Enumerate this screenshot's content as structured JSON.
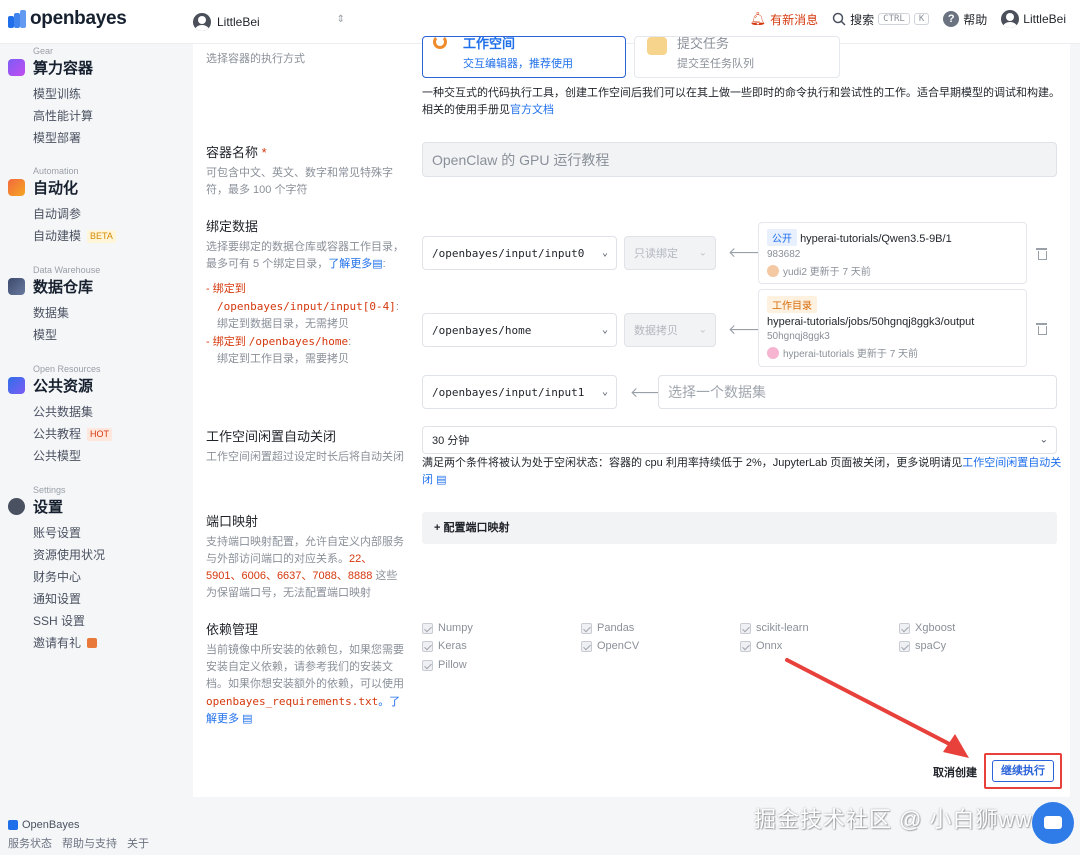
{
  "topbar": {
    "brand": "openbayes",
    "workspace": "LittleBei",
    "news": "有新消息",
    "search": "搜索",
    "kbd1": "CTRL",
    "kbd2": "K",
    "help": "帮助",
    "user": "LittleBei"
  },
  "sidebar": {
    "sections": [
      {
        "en": "Gear",
        "title": "算力容器",
        "items": [
          "模型训练",
          "高性能计算",
          "模型部署"
        ]
      },
      {
        "en": "Automation",
        "title": "自动化",
        "items": [
          "自动调参",
          "自动建模"
        ]
      },
      {
        "en": "Data Warehouse",
        "title": "数据仓库",
        "items": [
          "数据集",
          "模型"
        ]
      },
      {
        "en": "Open Resources",
        "title": "公共资源",
        "items": [
          "公共数据集",
          "公共教程",
          "公共模型"
        ]
      },
      {
        "en": "Settings",
        "title": "设置",
        "items": [
          "账号设置",
          "资源使用状况",
          "财务中心",
          "通知设置",
          "SSH 设置",
          "邀请有礼"
        ]
      }
    ],
    "beta_tag": "BETA",
    "hot_tag": "HOT",
    "footer_brand": "OpenBayes",
    "footer_links": [
      "服务状态",
      "帮助与支持",
      "关于"
    ]
  },
  "form": {
    "exec_mode": {
      "desc": "选择容器的执行方式",
      "card1_title": "工作空间",
      "card1_desc": "交互编辑器，推荐使用",
      "card2_title": "提交任务",
      "card2_desc": "提交至任务队列",
      "note_a": "一种交互式的代码执行工具，创建工作空间后我们可以在其上做一些即时的命令执行和尝试性的工作。适合早期模型的调试和构建。相关的使用手册见",
      "note_link": "官方文档"
    },
    "name": {
      "label": "容器名称",
      "required": "*",
      "desc": "可包含中文、英文、数字和常见特殊字符，最多 100 个字符",
      "value": "OpenClaw 的 GPU 运行教程"
    },
    "bind": {
      "label": "绑定数据",
      "desc_a": "选择要绑定的数据仓库或容器工作目录，最多可有 5 个绑定目录，",
      "desc_link": "了解更多",
      "desc_b": ":",
      "rule1_a": "- 绑定到",
      "rule1_path": "/openbayes/input/input[0-4]",
      "rule1_b": ":",
      "rule1_c": "绑定到数据目录，无需拷贝",
      "rule2_a": "- 绑定到",
      "rule2_path": "/openbayes/home",
      "rule2_b": ":",
      "rule2_c": "绑定到工作目录，需要拷贝",
      "rows": [
        {
          "path": "/openbayes/input/input0",
          "mode": "只读绑定",
          "tag": "公开",
          "title": "hyperai-tutorials/Qwen3.5-9B/1",
          "id": "983682",
          "meta": "yudi2 更新于 7 天前"
        },
        {
          "path": "/openbayes/home",
          "mode": "数据拷贝",
          "tag": "工作目录",
          "title": "hyperai-tutorials/jobs/50hgnqj8ggk3/output",
          "id": "50hgnqj8ggk3",
          "meta": "hyperai-tutorials 更新于 7 天前"
        }
      ],
      "row3_path": "/openbayes/input/input1",
      "row3_placeholder": "选择一个数据集"
    },
    "idle": {
      "label": "工作空间闲置自动关闭",
      "desc": "工作空间闲置超过设定时长后将自动关闭",
      "value": "30 分钟",
      "note_a": "满足两个条件将被认为处于空闲状态：容器的 cpu 利用率持续低于 2%，JupyterLab 页面被关闭，更多说明请见",
      "note_link": "工作空间闲置自动关闭"
    },
    "port": {
      "label": "端口映射",
      "desc_a": "支持端口映射配置，允许自定义内部服务与外部访问端口的对应关系。",
      "desc_ports": "22、5901、6006、6637、7088、8888",
      "desc_b": " 这些为保留端口号，无法配置端口映射",
      "bar": "+ 配置端口映射"
    },
    "deps": {
      "label": "依赖管理",
      "desc_a": "当前镜像中所安装的依赖包，如果您需要安装自定义依赖，请参考我们的安装文档。如果你想安装额外的依赖，可以使用",
      "desc_code": "openbayes_requirements.txt",
      "desc_link": "。了解更多",
      "packages": [
        "Numpy",
        "Pandas",
        "scikit-learn",
        "Xgboost",
        "Keras",
        "OpenCV",
        "Onnx",
        "spaCy",
        "Pillow"
      ]
    },
    "cancel": "取消创建",
    "submit": "继续执行"
  },
  "watermark": "掘金技术社区 @ 小白狮ww",
  "colors": {
    "accent": "#2b63d9",
    "highlight": "#e8403a",
    "link": "#1f6feb"
  }
}
